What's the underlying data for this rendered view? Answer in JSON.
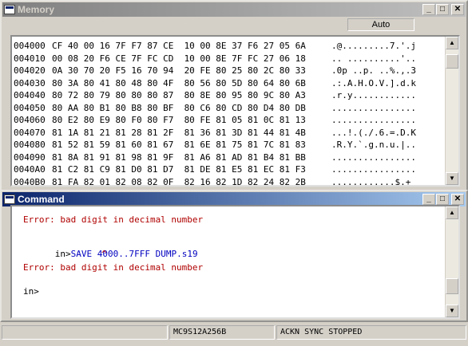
{
  "memory_window": {
    "title": "Memory",
    "mode": "Auto",
    "rows": [
      {
        "addr": "004000",
        "hex": "CF 40 00 16 7F F7 87 CE  10 00 8E 37 F6 27 05 6A",
        "ascii": ".@.........7.'.j"
      },
      {
        "addr": "004010",
        "hex": "00 08 20 F6 CE 7F FC CD  10 00 8E 7F FC 27 06 18",
        "ascii": ".. ..........'.."
      },
      {
        "addr": "004020",
        "hex": "0A 30 70 20 F5 16 70 94  20 FE 80 25 80 2C 80 33",
        "ascii": ".0p ..p. ..%.,.3"
      },
      {
        "addr": "004030",
        "hex": "80 3A 80 41 80 48 80 4F  80 56 80 5D 80 64 80 6B",
        "ascii": ".:.A.H.O.V.].d.k"
      },
      {
        "addr": "004040",
        "hex": "80 72 80 79 80 80 80 87  80 8E 80 95 80 9C 80 A3",
        "ascii": ".r.y............"
      },
      {
        "addr": "004050",
        "hex": "80 AA 80 B1 80 B8 80 BF  80 C6 80 CD 80 D4 80 DB",
        "ascii": "................"
      },
      {
        "addr": "004060",
        "hex": "80 E2 80 E9 80 F0 80 F7  80 FE 81 05 81 0C 81 13",
        "ascii": "................"
      },
      {
        "addr": "004070",
        "hex": "81 1A 81 21 81 28 81 2F  81 36 81 3D 81 44 81 4B",
        "ascii": "...!.(./.6.=.D.K"
      },
      {
        "addr": "004080",
        "hex": "81 52 81 59 81 60 81 67  81 6E 81 75 81 7C 81 83",
        "ascii": ".R.Y.`.g.n.u.|.."
      },
      {
        "addr": "004090",
        "hex": "81 8A 81 91 81 98 81 9F  81 A6 81 AD 81 B4 81 BB",
        "ascii": "................"
      },
      {
        "addr": "0040A0",
        "hex": "81 C2 81 C9 81 D0 81 D7  81 DE 81 E5 81 EC 81 F3",
        "ascii": "................"
      },
      {
        "addr": "0040B0",
        "hex": "81 FA 82 01 82 08 82 0F  82 16 82 1D 82 24 82 2B",
        "ascii": "............$.+"
      }
    ]
  },
  "command_window": {
    "title": "Command",
    "lines": {
      "error1": "Error: bad digit in decimal number",
      "prompt1": "in>",
      "command": "SAVE 4000..7FFF DUMP.s19",
      "caret": "^",
      "error2": "Error: bad digit in decimal number",
      "prompt2": "in>"
    }
  },
  "statusbar": {
    "device": "MC9S12A256B",
    "state": "ACKN SYNC STOPPED"
  }
}
